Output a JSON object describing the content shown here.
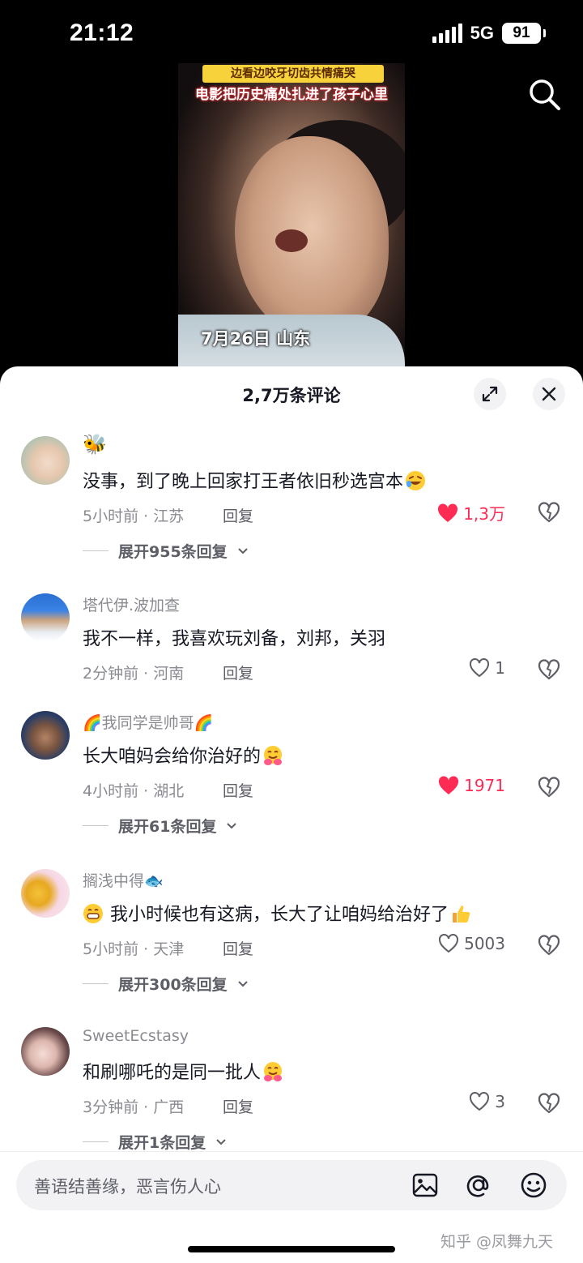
{
  "status_bar": {
    "time": "21:12",
    "network": "5G",
    "battery": "91"
  },
  "video": {
    "caption_top": "边看边咬牙切齿共情痛哭",
    "caption_main": "电影把历史痛处扎进了孩子心里",
    "date_tag": "7月26日 山东",
    "search_icon": "search-icon"
  },
  "comments_panel": {
    "title": "2,7万条评论",
    "expand_icon": "expand-icon",
    "close_icon": "close-icon",
    "reply_label": "回复",
    "comments": [
      {
        "name": "🐝",
        "text": "没事，到了晚上回家打王者依旧秒选宫本",
        "emoji": "rofl",
        "time_location": "5小时前 · 江苏",
        "likes": "1,3万",
        "liked": true,
        "replies": "展开955条回复"
      },
      {
        "name": "塔代伊.波加查",
        "text": "我不一样，我喜欢玩刘备，刘邦，关羽",
        "time_location": "2分钟前 · 河南",
        "likes": "1",
        "liked": false
      },
      {
        "name_prefix": "🌈",
        "name": "我同学是帅哥",
        "name_suffix": "🌈",
        "text": "长大咱妈会给你治好的",
        "emoji": "hug",
        "time_location": "4小时前 · 湖北",
        "likes": "1971",
        "liked": true,
        "replies": "展开61条回复"
      },
      {
        "name": "搁浅中得",
        "name_suffix": "🐟",
        "text": "我小时候也有这病，长大了让咱妈给治好了",
        "emoji_pre": "grin",
        "emoji": "thumbs-up",
        "time_location": "5小时前 · 天津",
        "likes": "5003",
        "liked": false,
        "replies": "展开300条回复"
      },
      {
        "name": "SweetEcstasy",
        "text": "和刷哪吒的是同一批人",
        "emoji": "hug",
        "time_location": "3分钟前 · 广西",
        "likes": "3",
        "liked": false,
        "replies": "展开1条回复"
      }
    ]
  },
  "input_bar": {
    "placeholder": "善语结善缘，恶言伤人心",
    "icons": [
      "image-icon",
      "at-icon",
      "emoji-icon"
    ],
    "watermark": "知乎 @凤舞九天"
  },
  "colors": {
    "like_red": "#fe2c55",
    "text": "#161823",
    "secondary": "#8a8b91",
    "sheet_bg": "#ffffff"
  }
}
